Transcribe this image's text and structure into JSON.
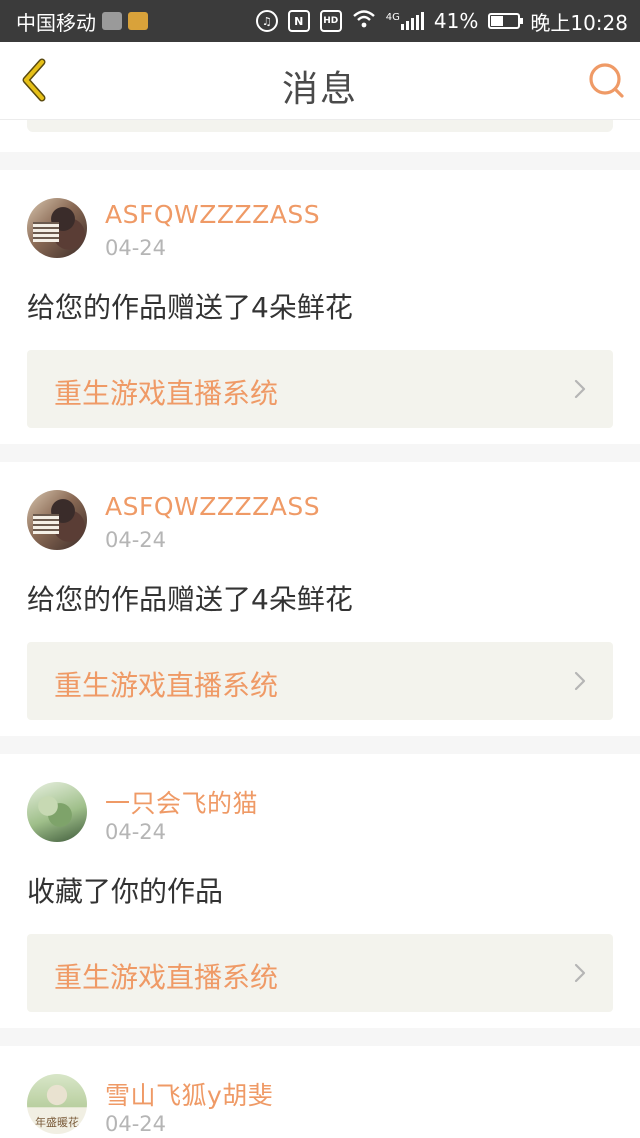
{
  "status_bar": {
    "carrier": "中国移动",
    "network": "4G",
    "battery": "41%",
    "time": "晚上10:28",
    "hd": "HD",
    "nfc": "N"
  },
  "header": {
    "title": "消息"
  },
  "colors": {
    "accent": "#ef9a66",
    "back_icon": "#e6c018",
    "search_icon": "#ef9a66"
  },
  "notifications": [
    {
      "username": "ASFQWZZZZASS",
      "date": "04-24",
      "message": "给您的作品赠送了4朵鲜花",
      "source": "重生游戏直播系统"
    },
    {
      "username": "ASFQWZZZZASS",
      "date": "04-24",
      "message": "给您的作品赠送了4朵鲜花",
      "source": "重生游戏直播系统"
    },
    {
      "username": "一只会飞的猫",
      "date": "04-24",
      "message": "收藏了你的作品",
      "source": "重生游戏直播系统"
    },
    {
      "username": "雪山飞狐y胡斐",
      "date": "04-24",
      "avatar_caption": "年盛暖花"
    }
  ]
}
